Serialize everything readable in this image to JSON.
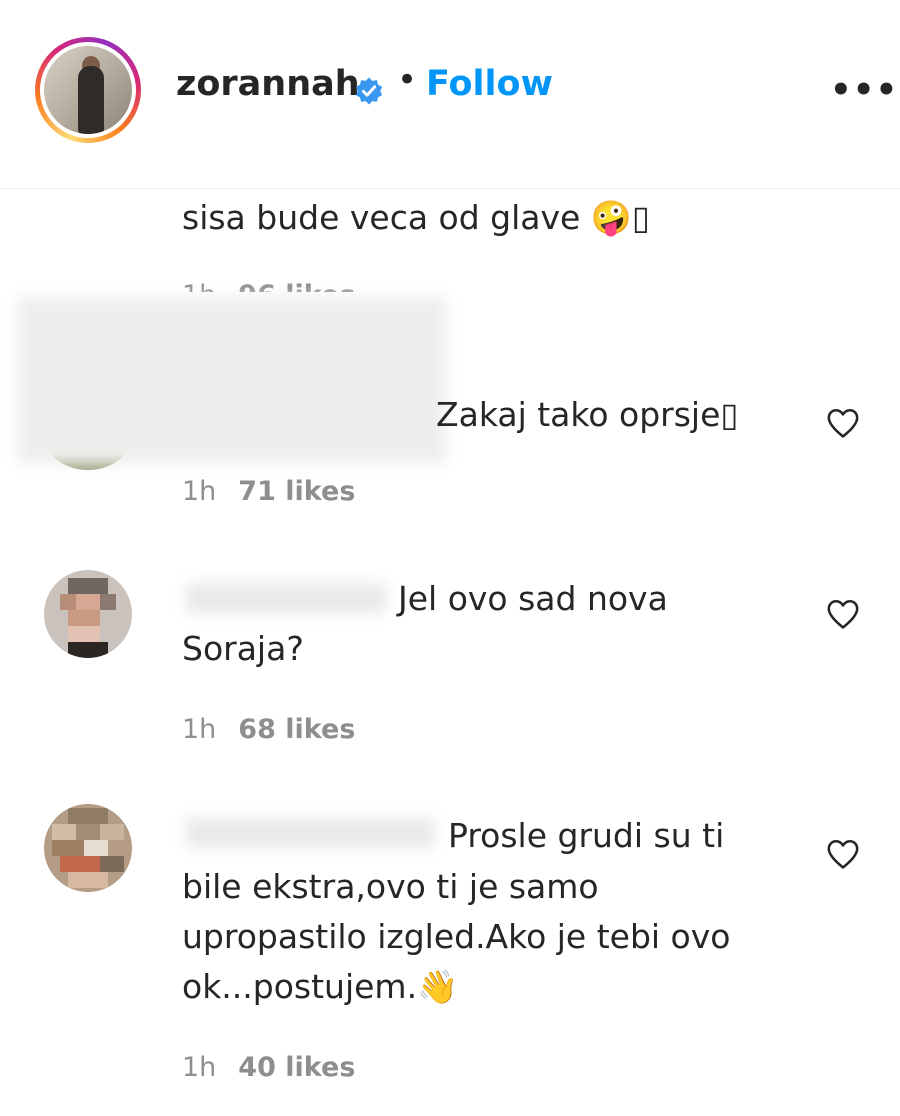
{
  "header": {
    "username": "zorannah",
    "separator": "•",
    "follow_label": "Follow",
    "more_label": "•••"
  },
  "comments": [
    {
      "text": "sisa bude veca od glave 🤪▯",
      "time": "1h",
      "likes": "96 likes"
    },
    {
      "text": "Zakaj tako oprsje▯",
      "time": "1h",
      "likes": "71 likes"
    },
    {
      "text_line1": "Jel ovo sad nova",
      "text_line2": "Soraja?",
      "time": "1h",
      "likes": "68 likes"
    },
    {
      "text_line1": "Prosle grudi su ti",
      "text_line2": "bile ekstra,ovo ti je samo",
      "text_line3": "upropastilo izgled.Ako je tebi ovo",
      "text_line4": "ok...postujem.👋",
      "time": "1h",
      "likes": "40 likes"
    }
  ],
  "colors": {
    "accent": "#0095f6",
    "verified": "#3897f0",
    "muted": "#8e8e8e"
  },
  "icons": [
    "verified-badge-icon",
    "heart-icon",
    "more-icon"
  ]
}
